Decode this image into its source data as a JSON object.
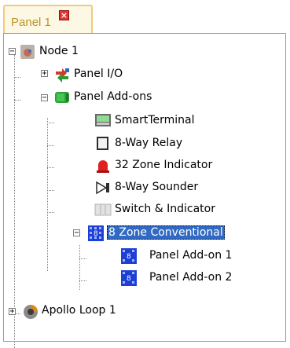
{
  "tab": {
    "label": "Panel 1",
    "close_glyph": "×"
  },
  "tree": {
    "node": {
      "label": "Node 1",
      "expander": "−"
    },
    "panel_io": {
      "label": "Panel I/O",
      "expander": "+"
    },
    "panel_addons": {
      "label": "Panel Add-ons",
      "expander": "−"
    },
    "smartterminal": {
      "label": "SmartTerminal"
    },
    "relay": {
      "label": "8-Way Relay"
    },
    "zone_indicator": {
      "label": "32 Zone Indicator"
    },
    "sounder": {
      "label": "8-Way Sounder"
    },
    "switch_indicator": {
      "label": "Switch & Indicator"
    },
    "zone_conventional": {
      "label": "8 Zone Conventional",
      "expander": "−",
      "selected": true
    },
    "addon1": {
      "label": "Panel Add-on 1"
    },
    "addon2": {
      "label": "Panel Add-on 2"
    },
    "apollo": {
      "label": "Apollo Loop 1",
      "expander": "+"
    }
  },
  "colors": {
    "selection": "#316ac5",
    "tab_text": "#b9942c",
    "tab_border": "#f2c97f",
    "close": "#e53232"
  }
}
